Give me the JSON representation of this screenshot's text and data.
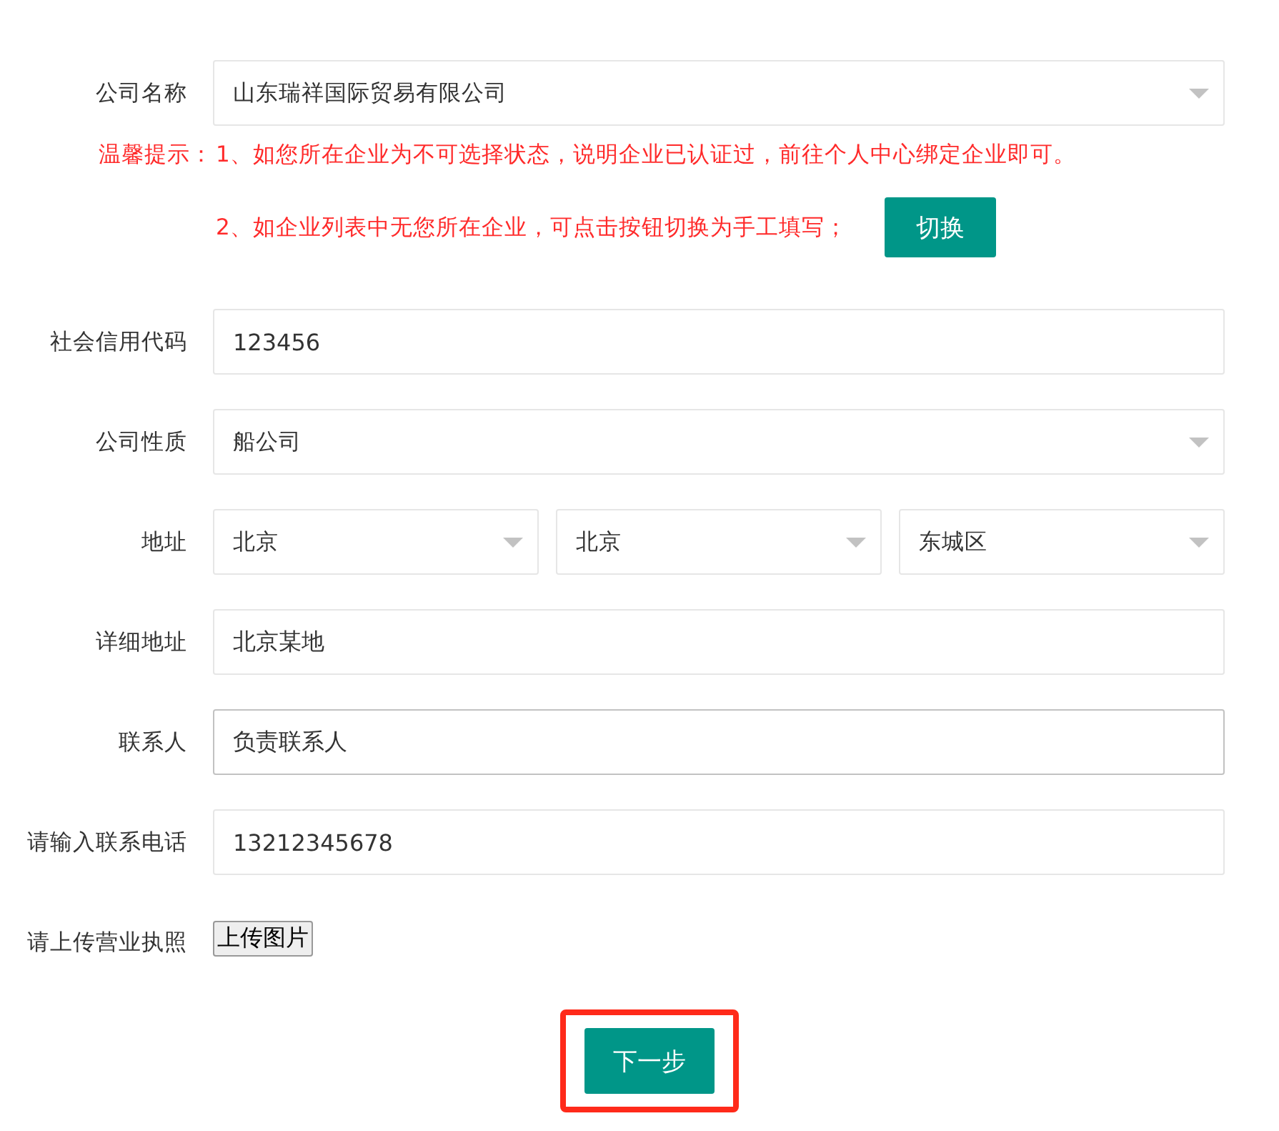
{
  "rows": [
    {
      "kind": "select",
      "label": "公司名称",
      "values": [
        "山东瑞祥国际贸易有限公司"
      ]
    },
    {
      "kind": "tips",
      "label": "温馨提示：",
      "lines": [
        "1、如您所在企业为不可选择状态，说明企业已认证过，前往个人中心绑定企业即可。",
        "2、如企业列表中无您所在企业，可点击按钮切换为手工填写；"
      ],
      "button": "切换"
    },
    {
      "kind": "text",
      "label": "社会信用代码",
      "value": "123456",
      "focused": false
    },
    {
      "kind": "select",
      "label": "公司性质",
      "values": [
        "船公司"
      ]
    },
    {
      "kind": "select",
      "label": "地址",
      "values": [
        "北京",
        "北京",
        "东城区"
      ]
    },
    {
      "kind": "text",
      "label": "详细地址",
      "value": "北京某地",
      "focused": false
    },
    {
      "kind": "text",
      "label": "联系人",
      "value": "负责联系人",
      "focused": true
    },
    {
      "kind": "text",
      "label": "请输入联系电话",
      "value": "13212345678",
      "focused": false
    },
    {
      "kind": "upload",
      "label": "请上传营业执照",
      "button": "上传图片"
    }
  ],
  "submit": {
    "label": "下一步",
    "highlighted": true
  }
}
